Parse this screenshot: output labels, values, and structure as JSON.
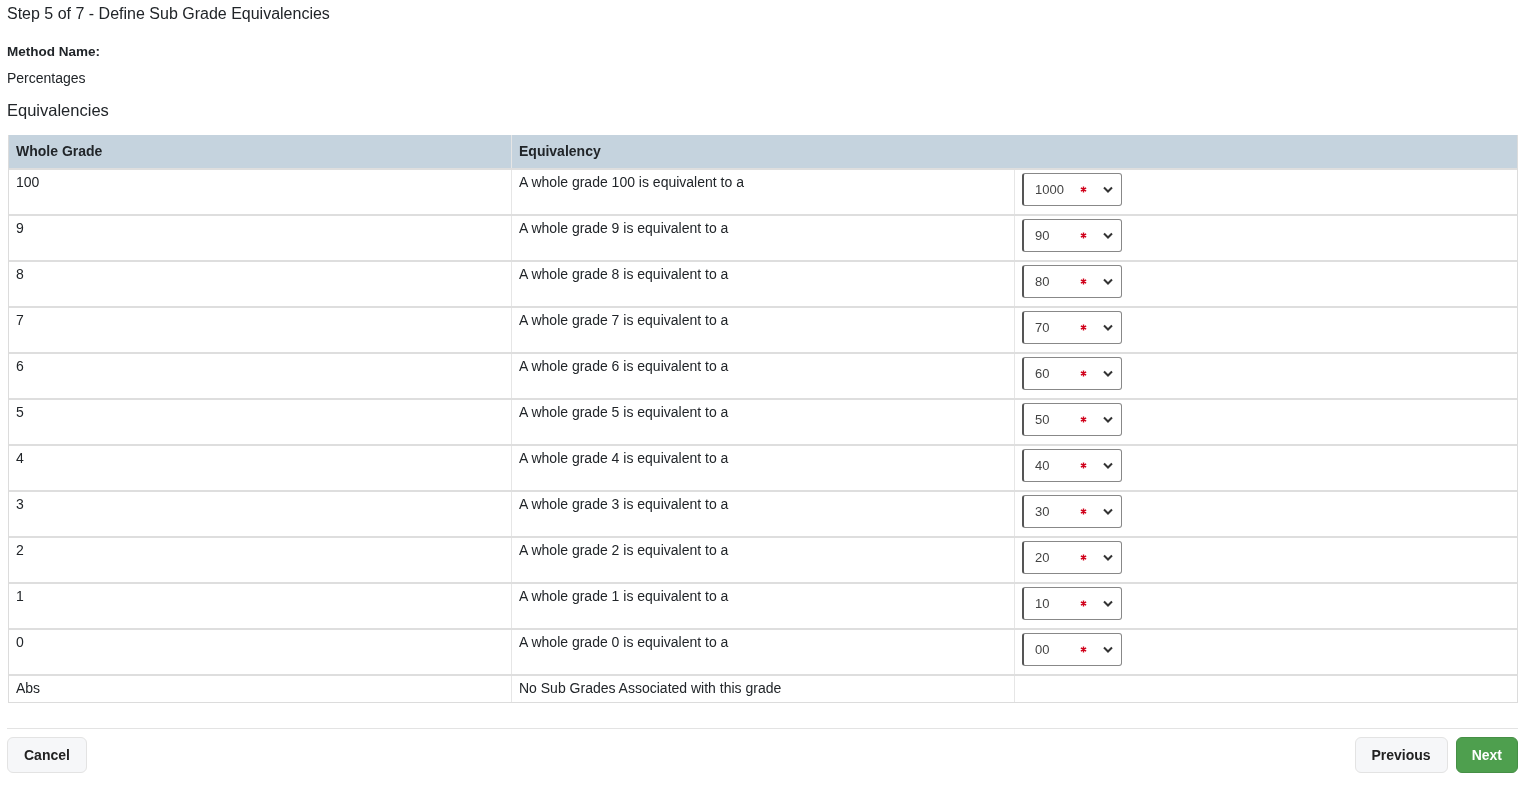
{
  "title": "Step 5 of 7 - Define Sub Grade Equivalencies",
  "method": {
    "label": "Method Name:",
    "value": "Percentages"
  },
  "section_title": "Equivalencies",
  "table": {
    "columns": [
      "Whole Grade",
      "Equivalency"
    ],
    "rows": [
      {
        "grade": "100",
        "text": "A whole grade 100 is equivalent to a",
        "select": "1000"
      },
      {
        "grade": "9",
        "text": "A whole grade 9 is equivalent to a",
        "select": "90"
      },
      {
        "grade": "8",
        "text": "A whole grade 8 is equivalent to a",
        "select": "80"
      },
      {
        "grade": "7",
        "text": "A whole grade 7 is equivalent to a",
        "select": "70"
      },
      {
        "grade": "6",
        "text": "A whole grade 6 is equivalent to a",
        "select": "60"
      },
      {
        "grade": "5",
        "text": "A whole grade 5 is equivalent to a",
        "select": "50"
      },
      {
        "grade": "4",
        "text": "A whole grade 4 is equivalent to a",
        "select": "40"
      },
      {
        "grade": "3",
        "text": "A whole grade 3 is equivalent to a",
        "select": "30"
      },
      {
        "grade": "2",
        "text": "A whole grade 2 is equivalent to a",
        "select": "20"
      },
      {
        "grade": "1",
        "text": "A whole grade 1 is equivalent to a",
        "select": "10"
      },
      {
        "grade": "0",
        "text": "A whole grade 0 is equivalent to a",
        "select": "00"
      },
      {
        "grade": "Abs",
        "text": "No Sub Grades Associated with this grade"
      }
    ]
  },
  "buttons": {
    "cancel": "Cancel",
    "previous": "Previous",
    "next": "Next"
  }
}
